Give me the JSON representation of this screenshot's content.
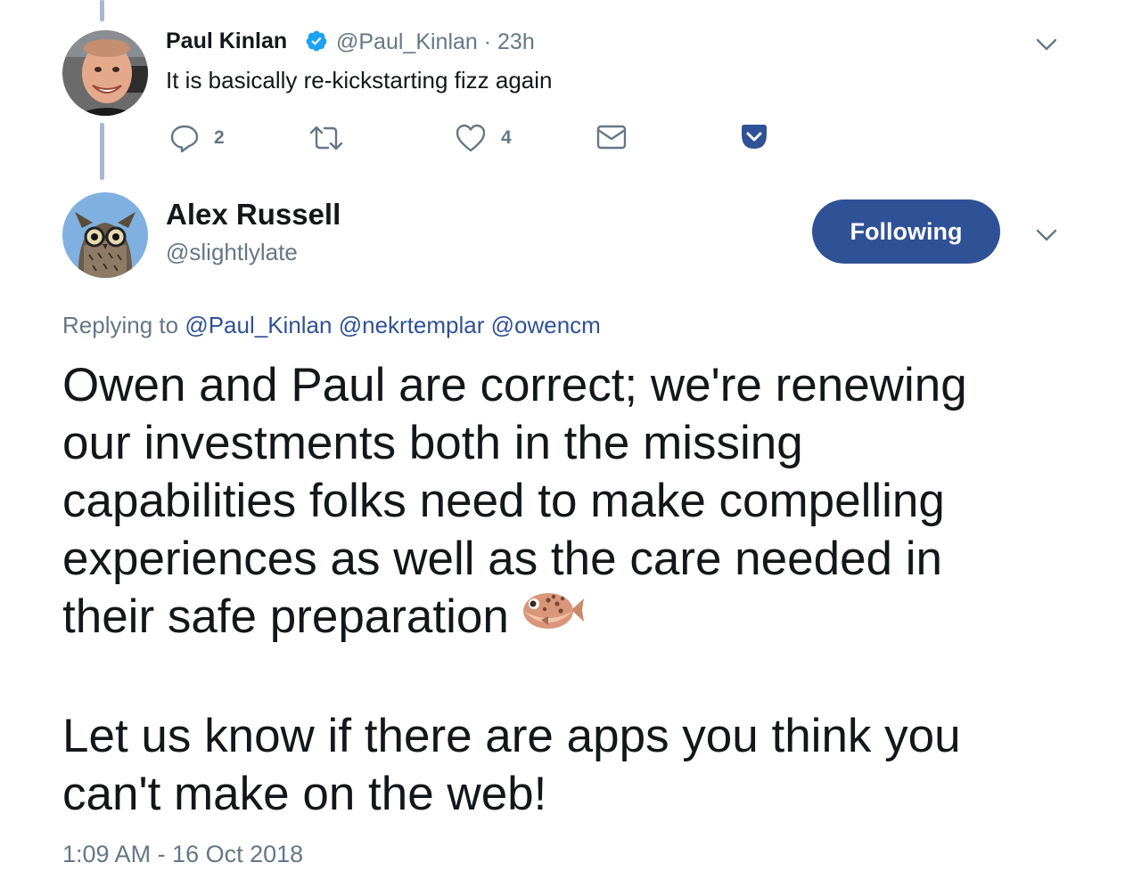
{
  "parent_tweet": {
    "author_name": "Paul Kinlan",
    "meta": "@Paul_Kinlan · 23h",
    "text": "It is basically re-kickstarting fizz again",
    "actions": {
      "reply_count": "2",
      "like_count": "4"
    }
  },
  "main_tweet": {
    "author_name": "Alex Russell",
    "author_handle": "@slightlylate",
    "follow_label": "Following",
    "replying_label": "Replying to",
    "replying_mentions": [
      "@Paul_Kinlan",
      "@nekrtemplar",
      "@owencm"
    ],
    "body_lines": [
      "Owen and Paul are correct; we're renewing",
      "our investments both in the missing",
      "capabilities folks need to make compelling",
      "experiences as well as the care needed in",
      "their safe preparation"
    ],
    "body_lines_2": [
      "Let us know if there are apps you think you",
      "can't make on the web!"
    ],
    "emoji": "blowfish-emoji",
    "timestamp": "1:09 AM - 16 Oct 2018"
  },
  "colors": {
    "brand": "#2f5196",
    "secondary_text": "#657786",
    "verified": "#1da1f2"
  }
}
